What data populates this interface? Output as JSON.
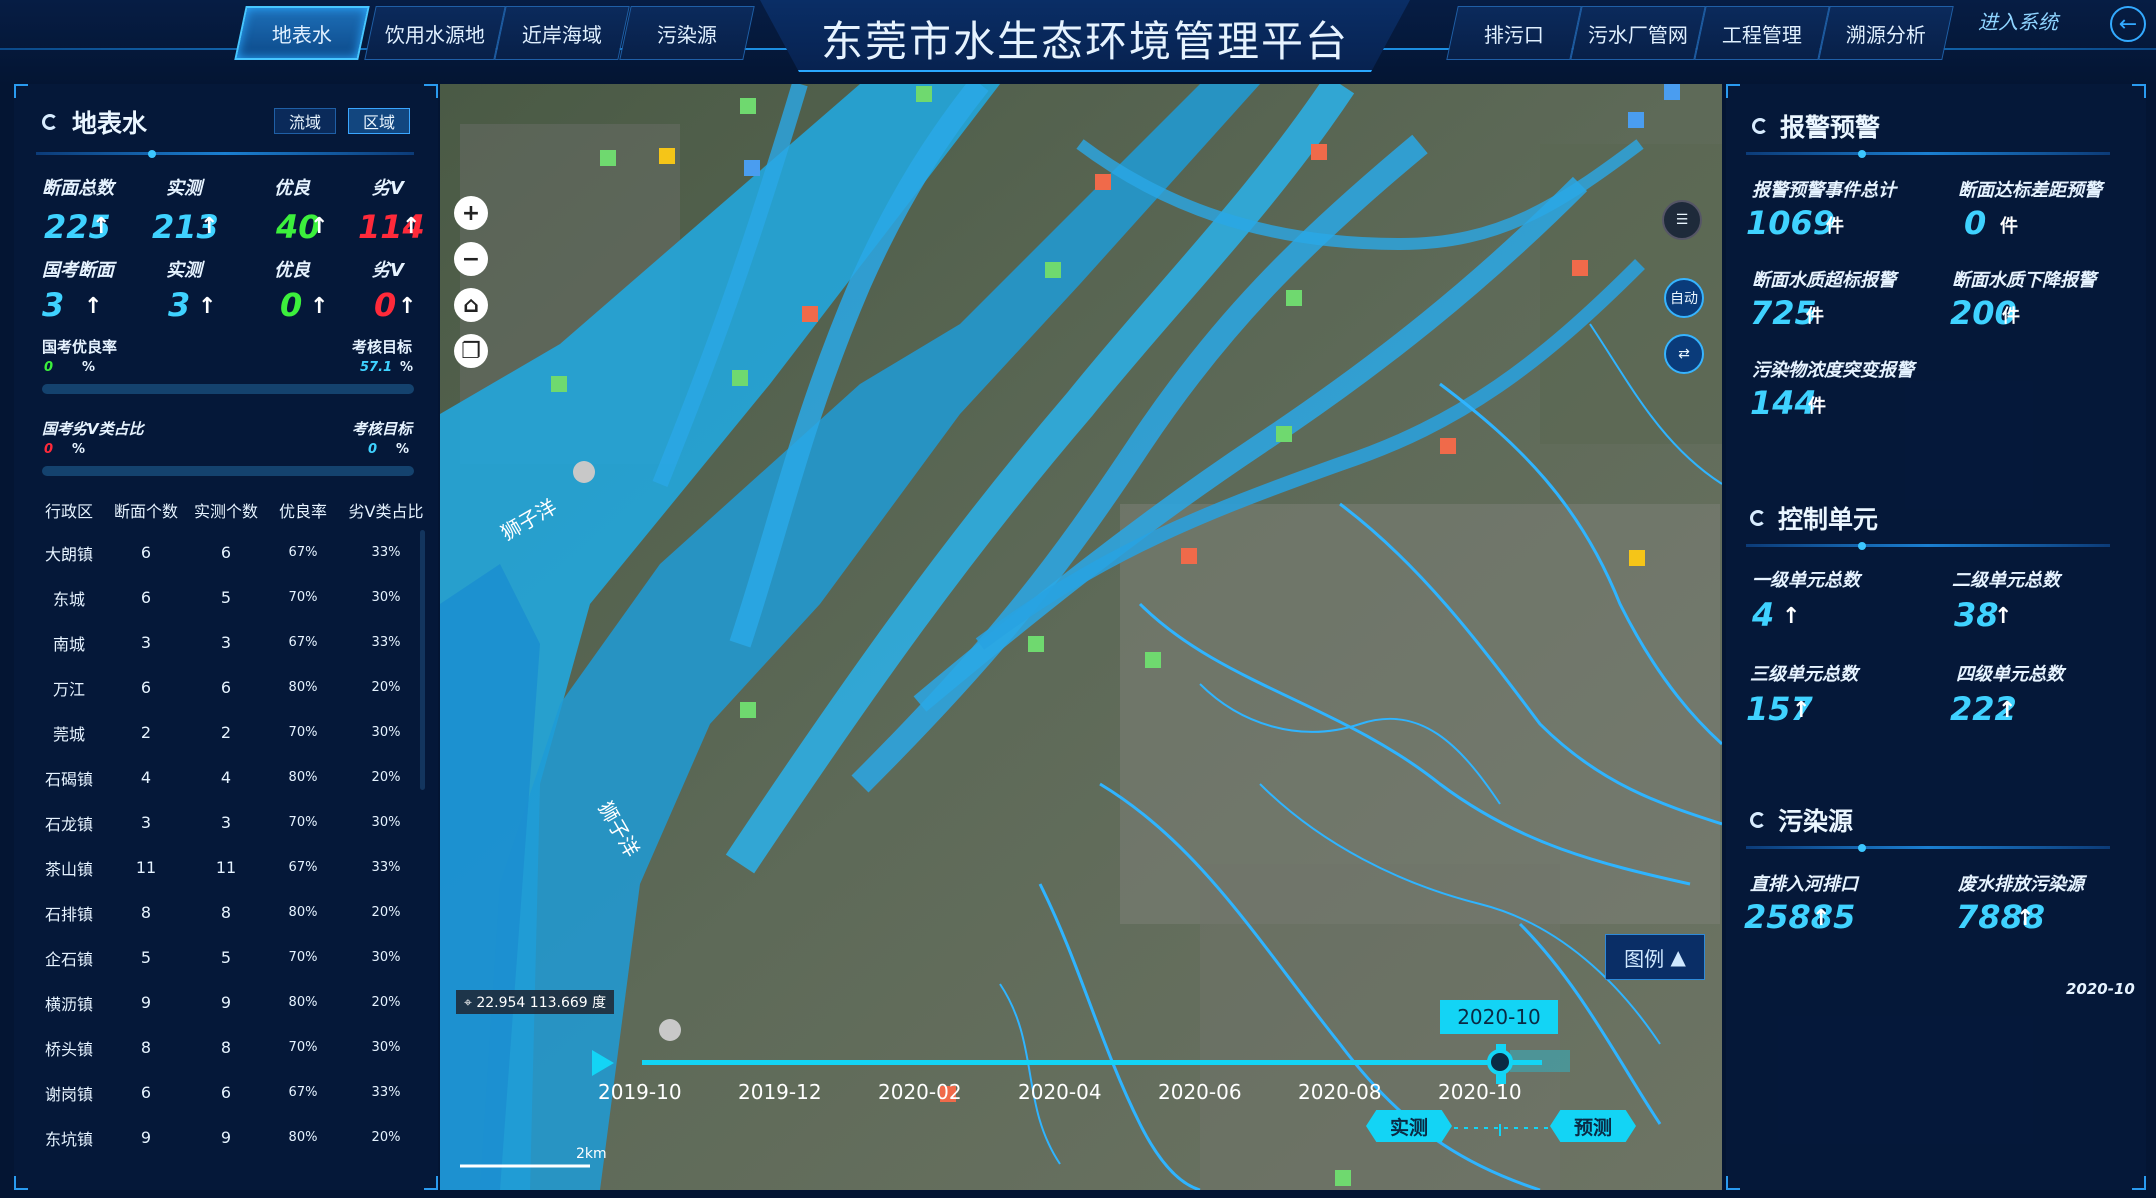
{
  "header": {
    "title": "东莞市水生态环境管理平台",
    "left_tabs": [
      "地表水",
      "饮用水源地",
      "近岸海域",
      "污染源"
    ],
    "right_tabs": [
      "排污口",
      "污水厂管网",
      "工程管理",
      "溯源分析"
    ],
    "active_tab": "地表水",
    "enter_system": "进入系统"
  },
  "left": {
    "title": "地表水",
    "toggle": [
      "流域",
      "区域"
    ],
    "toggle_active": "区域",
    "row1_labels": [
      "断面总数",
      "实测",
      "优良",
      "劣Ⅴ"
    ],
    "row1_values": [
      "225",
      "213",
      "40",
      "114"
    ],
    "row2_labels": [
      "国考断面",
      "实测",
      "优良",
      "劣Ⅴ"
    ],
    "row2_values": [
      "3",
      "3",
      "0",
      "0"
    ],
    "rate1_label": "国考优良率",
    "rate1_value": "0",
    "target1_label": "考核目标",
    "target1_value": "57.1",
    "rate2_label": "国考劣Ⅴ类占比",
    "rate2_value": "0",
    "target2_label": "考核目标",
    "target2_value": "0",
    "pct": "%",
    "table": {
      "headers": [
        "行政区",
        "断面个数",
        "实测个数",
        "优良率",
        "劣Ⅴ类占比"
      ],
      "rows": [
        [
          "大朗镇",
          "6",
          "6",
          "67%",
          "33%"
        ],
        [
          "东城",
          "6",
          "5",
          "70%",
          "30%"
        ],
        [
          "南城",
          "3",
          "3",
          "67%",
          "33%"
        ],
        [
          "万江",
          "6",
          "6",
          "80%",
          "20%"
        ],
        [
          "莞城",
          "2",
          "2",
          "70%",
          "30%"
        ],
        [
          "石碣镇",
          "4",
          "4",
          "80%",
          "20%"
        ],
        [
          "石龙镇",
          "3",
          "3",
          "70%",
          "30%"
        ],
        [
          "茶山镇",
          "11",
          "11",
          "67%",
          "33%"
        ],
        [
          "石排镇",
          "8",
          "8",
          "80%",
          "20%"
        ],
        [
          "企石镇",
          "5",
          "5",
          "70%",
          "30%"
        ],
        [
          "横沥镇",
          "9",
          "9",
          "80%",
          "20%"
        ],
        [
          "桥头镇",
          "8",
          "8",
          "70%",
          "30%"
        ],
        [
          "谢岗镇",
          "6",
          "6",
          "67%",
          "33%"
        ],
        [
          "东坑镇",
          "9",
          "9",
          "80%",
          "20%"
        ]
      ]
    }
  },
  "right": {
    "alarm_title": "报警预警",
    "alarm_labels": [
      "报警预警事件总计",
      "断面达标差距预警",
      "断面水质超标报警",
      "断面水质下降报警",
      "污染物浓度突变报警"
    ],
    "alarm_values": [
      "1069",
      "0",
      "725",
      "200",
      "144"
    ],
    "unit_jian": "件",
    "ctrl_title": "控制单元",
    "ctrl_labels": [
      "一级单元总数",
      "二级单元总数",
      "三级单元总数",
      "四级单元总数"
    ],
    "ctrl_values": [
      "4",
      "38",
      "157",
      "222"
    ],
    "poll_title": "污染源",
    "poll_labels": [
      "直排入河排口",
      "废水排放污染源"
    ],
    "poll_values": [
      "25885",
      "7888"
    ],
    "date": "2020-10"
  },
  "map": {
    "coord": "22.954 113.669 度",
    "legend": "图例",
    "scale": "2km",
    "auto_label": "自动",
    "river_labels": [
      "狮子洋",
      "狮子洋"
    ],
    "timeline_ticks": [
      "2019-10",
      "2019-12",
      "2020-02",
      "2020-04",
      "2020-06",
      "2020-08",
      "2020-10"
    ],
    "timeline_current": "2020-10",
    "timeline_progress": 1.0,
    "btn_actual": "实测",
    "btn_forecast": "预测"
  },
  "colors": {
    "accent": "#2aa8ff",
    "value_cyan": "#3fd2ff",
    "value_green": "#3cf03c",
    "value_red": "#ff2a3a",
    "timeline": "#13d4f5"
  }
}
